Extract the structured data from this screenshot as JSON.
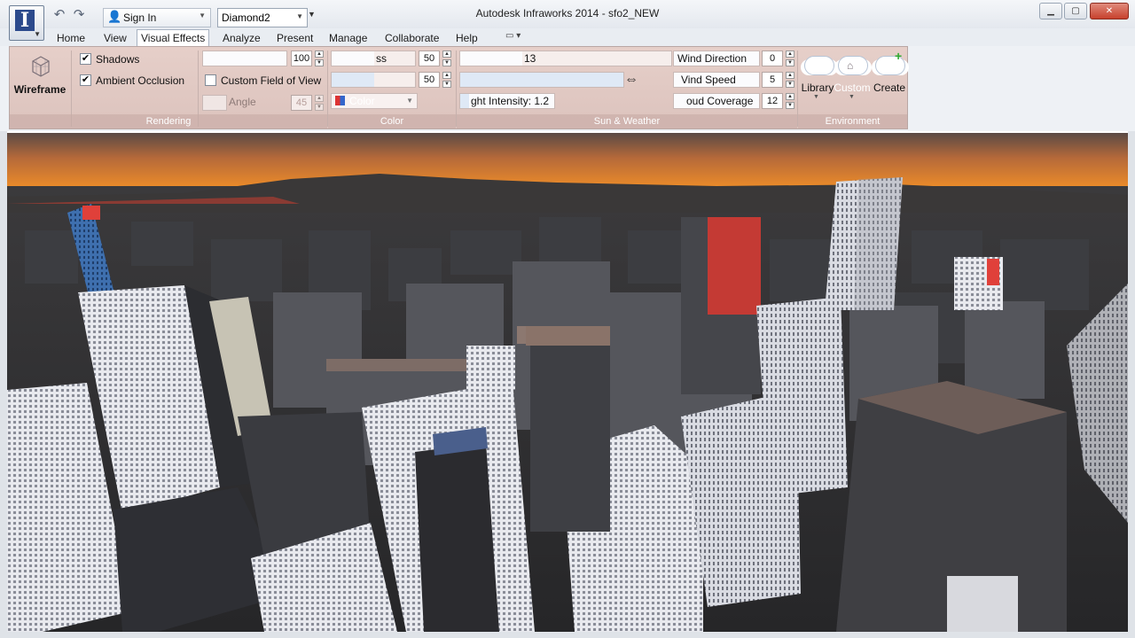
{
  "app": {
    "window_title": "Autodesk Infraworks 2014 - sfo2_NEW",
    "sign_in_label": "Sign In",
    "workspace_value": "Diamond2",
    "app_logo_letter": "I"
  },
  "tabs": [
    "Home",
    "View",
    "Visual Effects",
    "Analyze",
    "Present",
    "Manage",
    "Collaborate",
    "Help"
  ],
  "active_tab": "Visual Effects",
  "ribbon": {
    "wireframe_label": "Wireframe",
    "shadows_label": "Shadows",
    "shadows_checked": true,
    "ambient_occlusion_label": "Ambient Occlusion",
    "ambient_occlusion_checked": true,
    "custom_fov_label": "Custom Field of View",
    "custom_fov_checked": false,
    "angle_label": "Angle",
    "angle_value": "45",
    "slider1_value": "100",
    "ss_label": "ss",
    "ss_value": "50",
    "mid_slider_value": "50",
    "color_label": "Color",
    "date_fragment": "13",
    "light_intensity_label": "ght Intensity: 1.2",
    "wind_direction_label": "Wind Direction",
    "wind_direction_value": "0",
    "wind_speed_label": "Vind Speed",
    "wind_speed_value": "5",
    "cloud_coverage_label": "oud Coverage",
    "cloud_coverage_value": "12",
    "library_label": "Library",
    "custom_label": "Custom",
    "create_label": "Create",
    "group_titles": [
      "Rendering",
      "Color",
      "Sun & Weather",
      "Environment"
    ]
  },
  "icons": {
    "app_menu": "infraworks-logo-icon",
    "undo": "undo-icon",
    "redo": "redo-icon",
    "user": "person-icon",
    "minimize": "minimize-icon",
    "maximize": "maximize-icon",
    "close": "close-icon"
  },
  "colors": {
    "accent_blue": "#2c4a8c",
    "ribbon_tint": "#e6cfc9",
    "sky_orange": "#e98a2a"
  }
}
